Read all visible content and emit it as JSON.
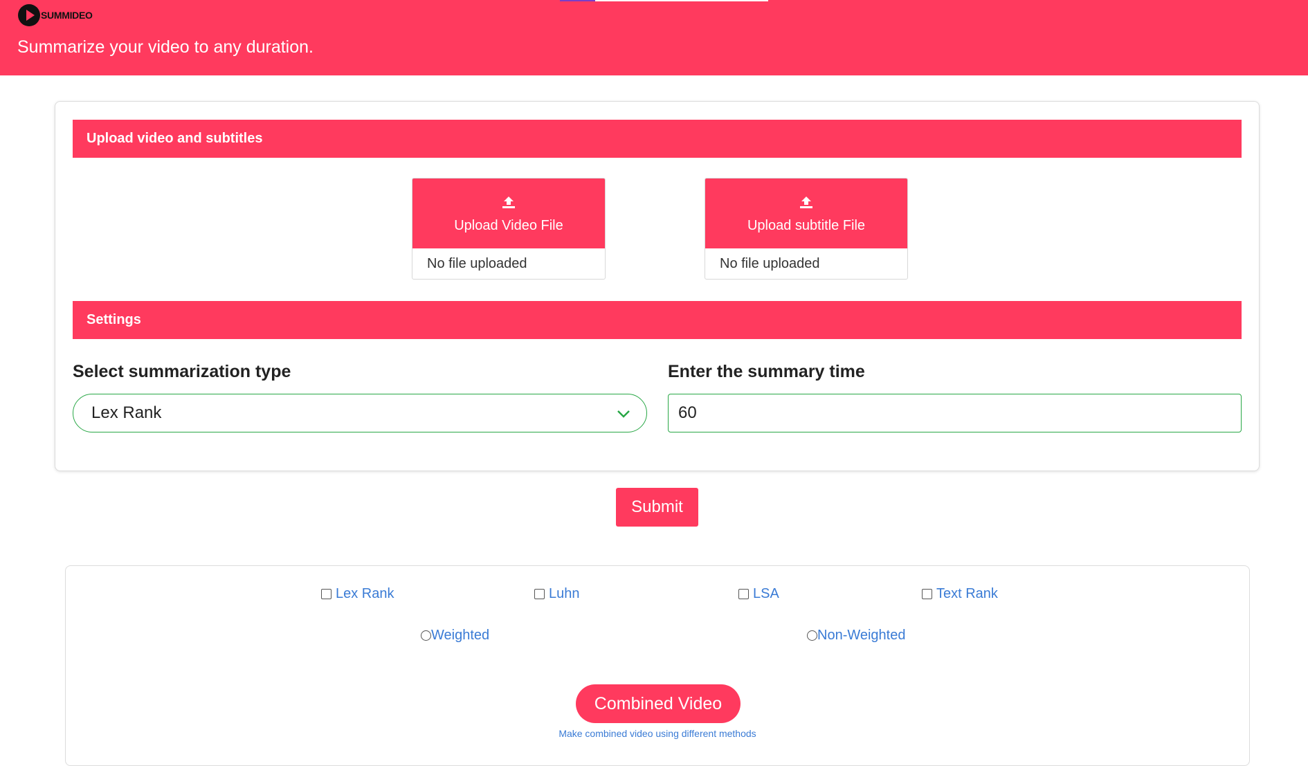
{
  "header": {
    "logo_text": "SUMMIDEO",
    "tagline": "Summarize your video to any duration.",
    "progress_fraction": 0.17,
    "colors": {
      "brand": "#ff3a5e",
      "progress": "#7a3ec9"
    }
  },
  "upload": {
    "section_title": "Upload video and subtitles",
    "video_button_label": "Upload Video File",
    "video_status": "No file uploaded",
    "subtitle_button_label": "Upload subtitle File",
    "subtitle_status": "No file uploaded",
    "icon": "upload-icon"
  },
  "settings": {
    "section_title": "Settings",
    "type_label": "Select summarization type",
    "type_selected": "Lex Rank",
    "time_label": "Enter the summary time",
    "time_value": "60"
  },
  "submit_label": "Submit",
  "methods": {
    "checkboxes": [
      {
        "label": "Lex Rank",
        "checked": false
      },
      {
        "label": "Luhn",
        "checked": false
      },
      {
        "label": "LSA",
        "checked": false
      },
      {
        "label": "Text Rank",
        "checked": false
      }
    ],
    "radios": [
      {
        "label": "Weighted",
        "checked": false
      },
      {
        "label": "Non-Weighted",
        "checked": false
      }
    ],
    "combined_button_label": "Combined Video",
    "combined_hint": "Make combined video using different methods"
  }
}
